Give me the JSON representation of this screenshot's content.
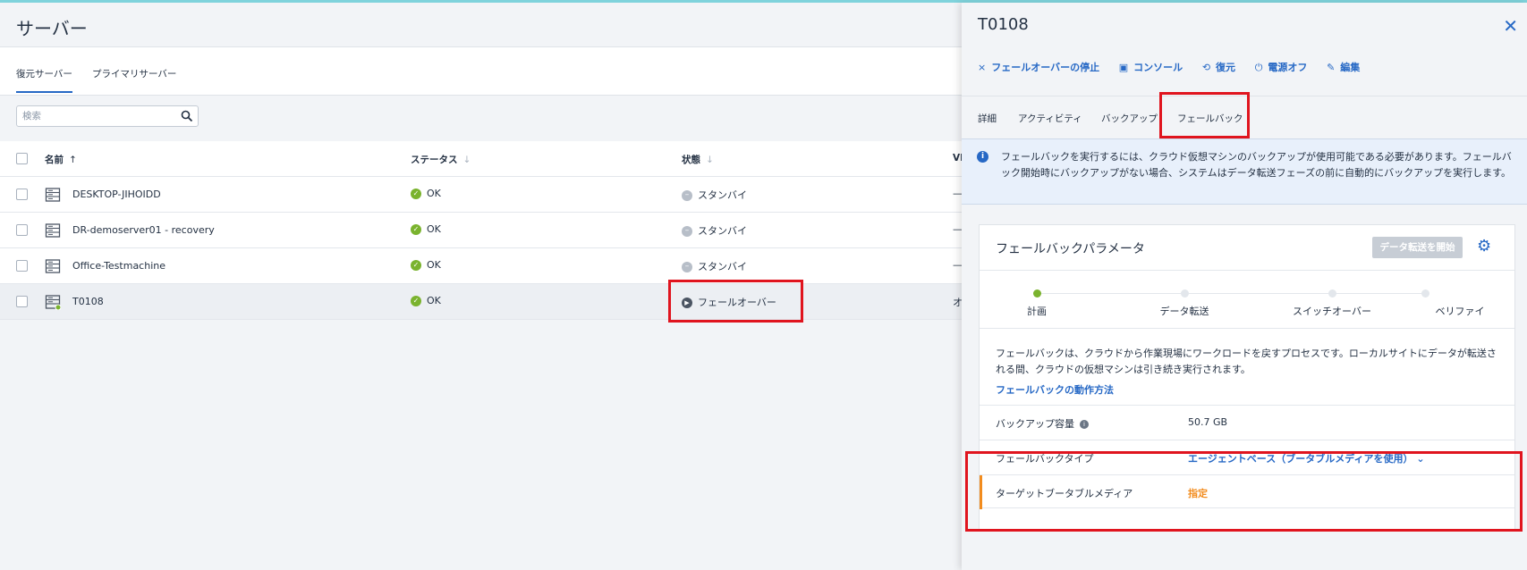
{
  "page": {
    "title": "サーバー"
  },
  "subtabs": [
    {
      "label": "復元サーバー",
      "active": true
    },
    {
      "label": "プライマリサーバー",
      "active": false
    }
  ],
  "search": {
    "placeholder": "検索",
    "icon": "search-icon"
  },
  "table": {
    "columns": {
      "name": "名前",
      "status": "ステータス",
      "state": "状態",
      "vm": "VI"
    },
    "sort_icons": {
      "name": "↑",
      "status": "↓",
      "state": "↓"
    },
    "rows": [
      {
        "name": "DESKTOP-JIHOIDD",
        "status": "OK",
        "state": "スタンバイ",
        "vm": "—"
      },
      {
        "name": "DR-demoserver01 - recovery",
        "status": "OK",
        "state": "スタンバイ",
        "vm": "—"
      },
      {
        "name": "Office-Testmachine",
        "status": "OK",
        "state": "スタンバイ",
        "vm": "—"
      },
      {
        "name": "T0108",
        "status": "OK",
        "state": "フェールオーバー",
        "vm": "オ"
      }
    ]
  },
  "panel": {
    "title": "T0108",
    "close_icon": "close-icon",
    "toolbar": [
      {
        "label": "フェールオーバーの停止",
        "icon": "×"
      },
      {
        "label": "コンソール",
        "icon": "▣"
      },
      {
        "label": "復元",
        "icon": "⟲"
      },
      {
        "label": "電源オフ",
        "icon": "⏻"
      },
      {
        "label": "編集",
        "icon": "✎"
      }
    ],
    "tabs": [
      {
        "label": "詳細",
        "active": false
      },
      {
        "label": "アクティビティ",
        "active": false
      },
      {
        "label": "バックアップ",
        "active": false
      },
      {
        "label": "フェールバック",
        "active": true
      }
    ],
    "info_text": "フェールバックを実行するには、クラウド仮想マシンのバックアップが使用可能である必要があります。フェールバック開始時にバックアップがない場合、システムはデータ転送フェーズの前に自動的にバックアップを実行します。",
    "card": {
      "title": "フェールバックパラメータ",
      "start_button": "データ転送を開始",
      "steps": [
        "計画",
        "データ転送",
        "スイッチオーバー",
        "ベリファイ"
      ],
      "current_step": 0,
      "description": "フェールバックは、クラウドから作業現場にワークロードを戻すプロセスです。ローカルサイトにデータが転送される間、クラウドの仮想マシンは引き続き実行されます。",
      "link": "フェールバックの動作方法",
      "params": [
        {
          "label": "バックアップ容量",
          "value": "50.7 GB"
        },
        {
          "label": "フェールバックタイプ",
          "value": "エージェントベース（ブータブルメディアを使用）"
        },
        {
          "label": "ターゲットブータブルメディア",
          "value": "指定"
        }
      ]
    }
  },
  "colors": {
    "accent": "#2668c5",
    "ok": "#7ab32e",
    "warning": "#f28c1e",
    "highlight": "#e0141e"
  }
}
